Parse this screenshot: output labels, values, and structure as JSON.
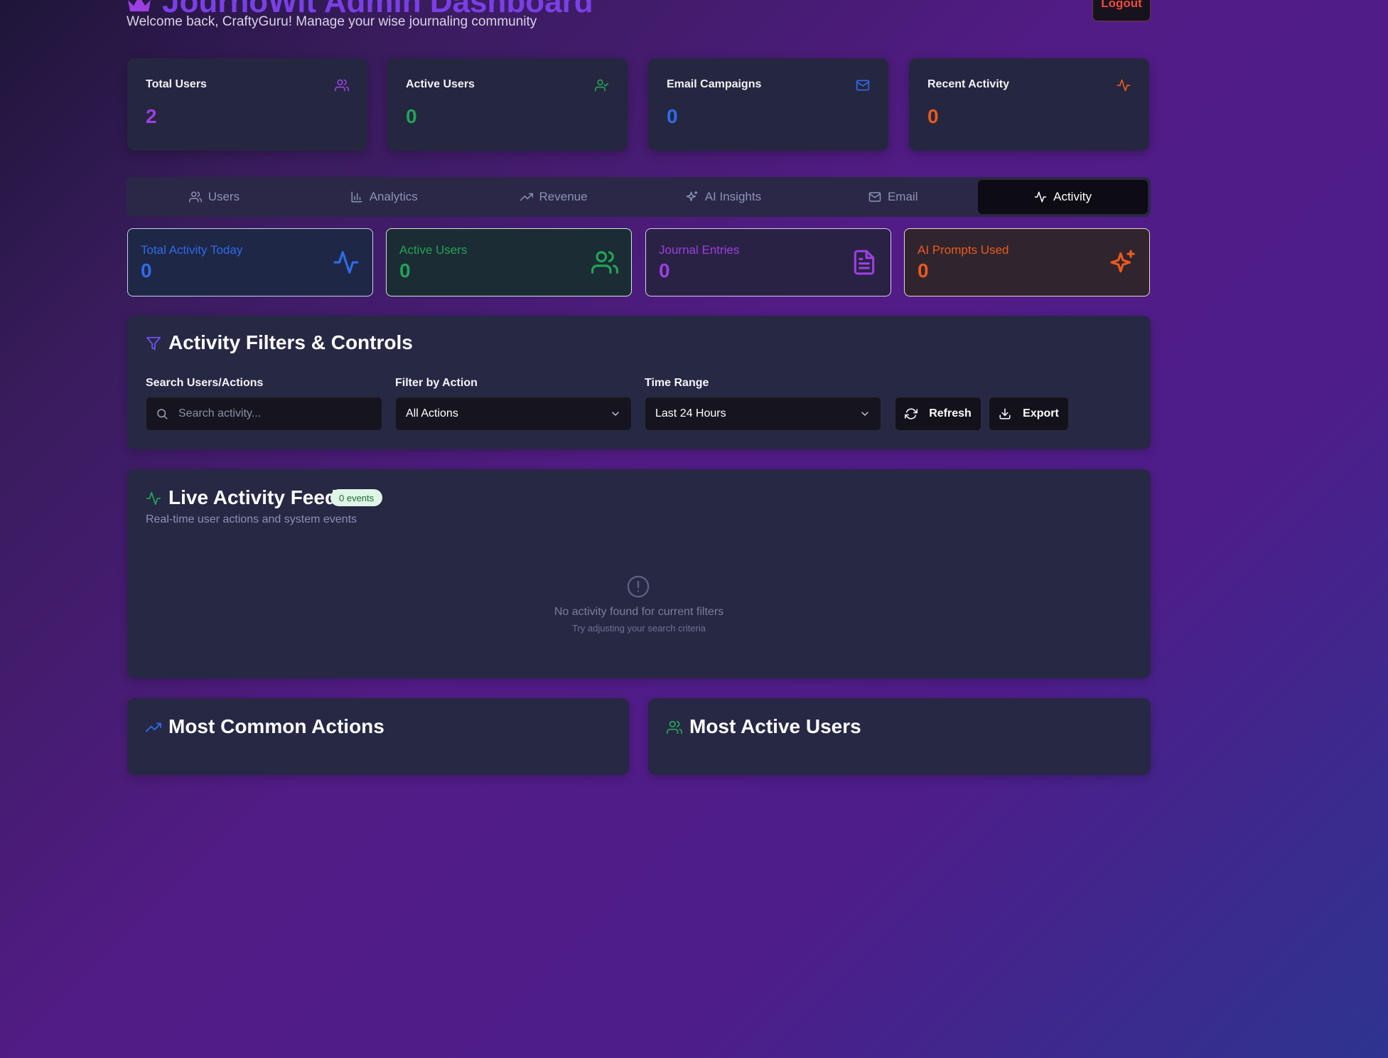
{
  "header": {
    "title": "JournoWit Admin Dashboard",
    "subtitle": "Welcome back, CraftyGuru! Manage your wise journaling community",
    "logout_label": "Logout"
  },
  "stats": [
    {
      "label": "Total Users",
      "value": "2",
      "color": "#9b3fe0",
      "icon": "users-icon"
    },
    {
      "label": "Active Users",
      "value": "0",
      "color": "#22a356",
      "icon": "user-check-icon"
    },
    {
      "label": "Email Campaigns",
      "value": "0",
      "color": "#2f6bea",
      "icon": "mail-icon"
    },
    {
      "label": "Recent Activity",
      "value": "0",
      "color": "#ea5a1c",
      "icon": "activity-icon"
    }
  ],
  "tabs": [
    {
      "label": "Users",
      "icon": "users-icon"
    },
    {
      "label": "Analytics",
      "icon": "bar-chart-icon"
    },
    {
      "label": "Revenue",
      "icon": "trending-up-icon"
    },
    {
      "label": "AI Insights",
      "icon": "sparkles-icon"
    },
    {
      "label": "Email",
      "icon": "mail-icon"
    },
    {
      "label": "Activity",
      "icon": "activity-icon",
      "active": true
    }
  ],
  "metrics": [
    {
      "label": "Total Activity Today",
      "value": "0",
      "color": "#2f6bea"
    },
    {
      "label": "Active Users",
      "value": "0",
      "color": "#22a356"
    },
    {
      "label": "Journal Entries",
      "value": "0",
      "color": "#9b3fe0"
    },
    {
      "label": "AI Prompts Used",
      "value": "0",
      "color": "#ea5a1c"
    }
  ],
  "filters": {
    "title": "Activity Filters & Controls",
    "search_label": "Search Users/Actions",
    "search_placeholder": "Search activity...",
    "action_label": "Filter by Action",
    "action_value": "All Actions",
    "time_label": "Time Range",
    "time_value": "Last 24 Hours",
    "refresh_label": "Refresh",
    "export_label": "Export"
  },
  "feed": {
    "title": "Live Activity Feed",
    "badge": "0 events",
    "subtitle": "Real-time user actions and system events",
    "empty_title": "No activity found for current filters",
    "empty_hint": "Try adjusting your search criteria"
  },
  "common_actions": {
    "title": "Most Common Actions"
  },
  "active_users": {
    "title": "Most Active Users"
  }
}
